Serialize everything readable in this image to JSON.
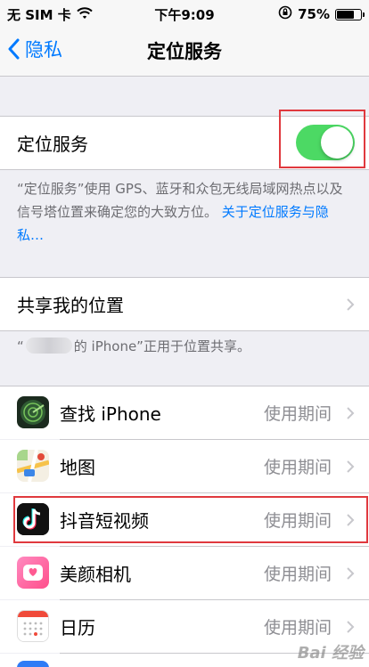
{
  "status_bar": {
    "carrier": "无 SIM 卡",
    "time": "下午9:09",
    "battery_percent": "75%",
    "battery_level": 0.75,
    "icons": [
      "wifi-icon",
      "orientation-lock-icon",
      "battery-icon"
    ]
  },
  "nav": {
    "back_label": "隐私",
    "title": "定位服务"
  },
  "location_services": {
    "label": "定位服务",
    "enabled": true,
    "description": "“定位服务”使用 GPS、蓝牙和众包无线局域网热点以及信号塔位置来确定您的大致方位。",
    "link_text": "关于定位服务与隐私…"
  },
  "share_location": {
    "label": "共享我的位置",
    "note_suffix": "的 iPhone”正用于位置共享。",
    "note_prefix": "“"
  },
  "apps": [
    {
      "name": "查找 iPhone",
      "value": "使用期间",
      "icon": "find-iphone-icon"
    },
    {
      "name": "地图",
      "value": "使用期间",
      "icon": "maps-icon"
    },
    {
      "name": "抖音短视频",
      "value": "使用期间",
      "icon": "douyin-icon"
    },
    {
      "name": "美颜相机",
      "value": "使用期间",
      "icon": "beauty-camera-icon"
    },
    {
      "name": "日历",
      "value": "使用期间",
      "icon": "calendar-icon"
    }
  ],
  "colors": {
    "accent": "#007aff",
    "toggle_on": "#4cd964",
    "highlight_box": "#e0393e"
  },
  "watermark": "Bai 经验"
}
